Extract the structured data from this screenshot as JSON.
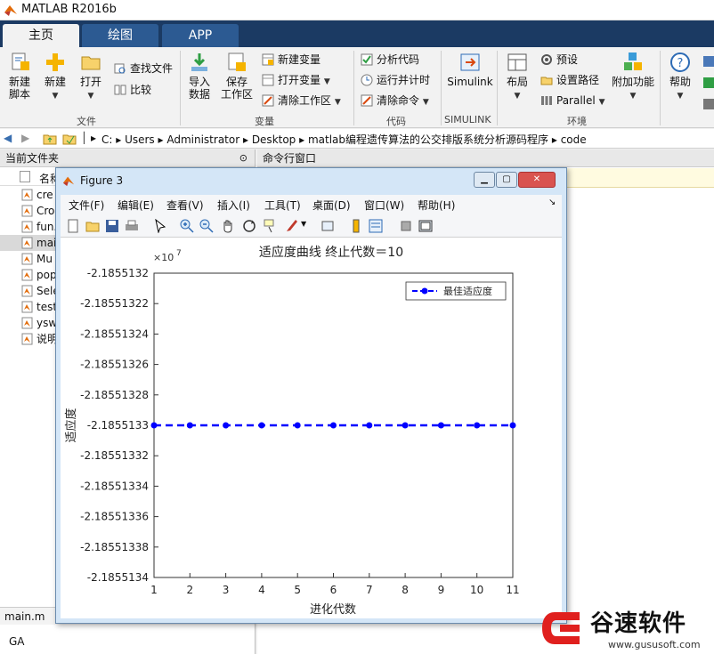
{
  "window": {
    "title": "MATLAB R2016b"
  },
  "tabs": [
    {
      "label": "主页"
    },
    {
      "label": "绘图"
    },
    {
      "label": "APP"
    }
  ],
  "ribbon": {
    "file_group": {
      "label": "文件",
      "new_script": "新建\n脚本",
      "new": "新建",
      "open": "打开",
      "find_files": "查找文件",
      "compare": "比较"
    },
    "variable_group": {
      "label": "变量",
      "import_data": "导入\n数据",
      "save_workspace": "保存\n工作区",
      "new_variable": "新建变量",
      "open_variable": "打开变量",
      "clear_workspace": "清除工作区"
    },
    "code_group": {
      "label": "代码",
      "analyze_code": "分析代码",
      "run_and_time": "运行并计时",
      "clear_commands": "清除命令"
    },
    "simulink_group": {
      "label": "SIMULINK",
      "simulink": "Simulink"
    },
    "env_group": {
      "label": "环境",
      "layout": "布局",
      "preferences": "预设",
      "set_path": "设置路径",
      "parallel": "Parallel",
      "addons": "附加功能"
    },
    "help": "帮助"
  },
  "address": {
    "crumbs": [
      "C:",
      "Users",
      "Administrator",
      "Desktop",
      "matlab编程遗传算法的公交排版系统分析源码程序",
      "code"
    ]
  },
  "current_folder": {
    "title": "当前文件夹",
    "column_name": "名称",
    "files": [
      "cre",
      "Cro",
      "fun.",
      "mai",
      "Mu",
      "pop",
      "Sele",
      "test",
      "ysw",
      "说明"
    ],
    "selected_index": 3,
    "bottom_tab": "main.m",
    "detail_text": "GA"
  },
  "command_window": {
    "title": "命令行窗口"
  },
  "figure": {
    "title": "Figure 3",
    "menu": [
      "文件(F)",
      "编辑(E)",
      "查看(V)",
      "插入(I)",
      "工具(T)",
      "桌面(D)",
      "窗口(W)",
      "帮助(H)"
    ],
    "toolbar_icons": [
      "new-figure-icon",
      "open-icon",
      "save-icon",
      "print-icon",
      "pointer-icon",
      "zoom-in-icon",
      "zoom-out-icon",
      "pan-icon",
      "rotate-icon",
      "data-cursor-icon",
      "brush-icon",
      "link-icon",
      "colorbar-icon",
      "legend-icon",
      "hide-plot-tools-icon",
      "show-plot-tools-icon"
    ]
  },
  "chart_data": {
    "type": "line",
    "title": "适应度曲线  终止代数＝10",
    "xlabel": "进化代数",
    "ylabel": "适应度",
    "exponent_label": "×10",
    "exponent_power": "7",
    "x": [
      1,
      2,
      3,
      4,
      5,
      6,
      7,
      8,
      9,
      10,
      11
    ],
    "series": [
      {
        "name": "最佳适应度",
        "values": [
          -2.1855133,
          -2.1855133,
          -2.1855133,
          -2.1855133,
          -2.1855133,
          -2.1855133,
          -2.1855133,
          -2.1855133,
          -2.1855133,
          -2.1855133,
          -2.1855133
        ],
        "color": "#0000ff",
        "style": "dashed-marker"
      }
    ],
    "xlim": [
      1,
      11
    ],
    "ylim": [
      -2.1855134,
      -2.1855132
    ],
    "xticks": [
      "1",
      "2",
      "3",
      "4",
      "5",
      "6",
      "7",
      "8",
      "9",
      "10",
      "11"
    ],
    "yticks": [
      "-2.1855132",
      "-2.18551322",
      "-2.18551324",
      "-2.18551326",
      "-2.18551328",
      "-2.1855133",
      "-2.18551332",
      "-2.18551334",
      "-2.18551336",
      "-2.18551338",
      "-2.1855134"
    ],
    "grid": false,
    "legend_position": "top-right"
  },
  "watermark": {
    "text": "谷速软件",
    "url": "www.gususoft.com"
  },
  "colors": {
    "tab_bg": "#1b3a63",
    "accent_blue": "#0000ff",
    "watermark_red": "#e0201e"
  }
}
